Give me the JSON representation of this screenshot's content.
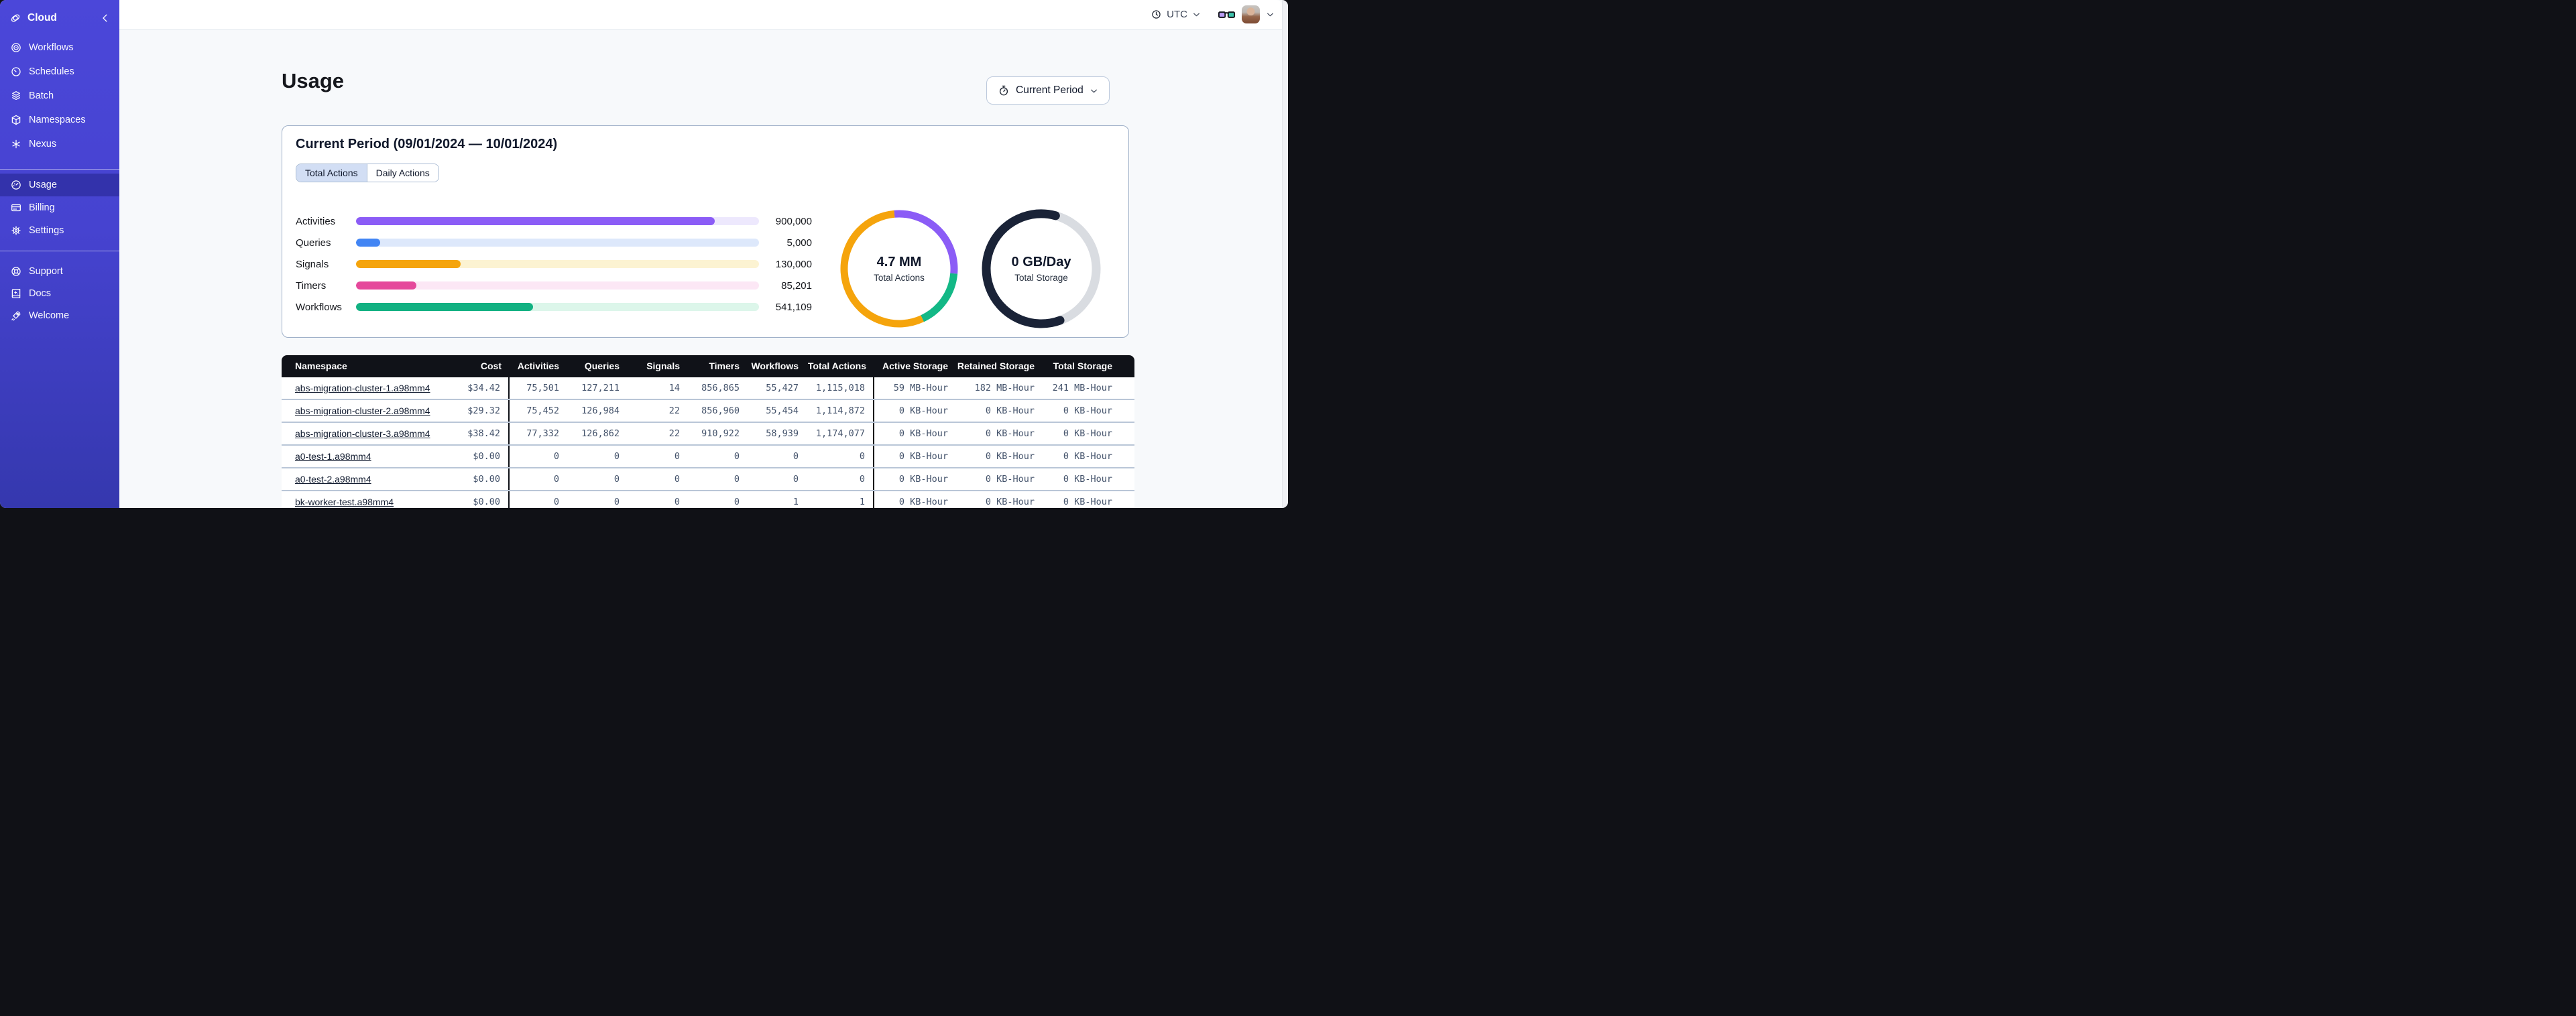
{
  "sidebar": {
    "brand": {
      "label": "Cloud"
    },
    "nav_primary": [
      {
        "label": "Workflows"
      },
      {
        "label": "Schedules"
      },
      {
        "label": "Batch"
      },
      {
        "label": "Namespaces"
      },
      {
        "label": "Nexus"
      }
    ],
    "nav_account": [
      {
        "label": "Usage",
        "active": true
      },
      {
        "label": "Billing",
        "active": false
      },
      {
        "label": "Settings",
        "active": false
      }
    ],
    "nav_footer": [
      {
        "label": "Support"
      },
      {
        "label": "Docs"
      },
      {
        "label": "Welcome"
      }
    ]
  },
  "header": {
    "timezone": "UTC"
  },
  "page": {
    "title": "Usage",
    "period_button_label": "Current Period"
  },
  "usage_card": {
    "title": "Current Period (09/01/2024 — 10/01/2024)",
    "tabs": [
      {
        "label": "Total Actions",
        "active": true
      },
      {
        "label": "Daily Actions",
        "active": false
      }
    ]
  },
  "chart_data": [
    {
      "type": "bar",
      "title": "Actions by type (current period)",
      "categories": [
        "Activities",
        "Queries",
        "Signals",
        "Timers",
        "Workflows"
      ],
      "values": [
        900000,
        5000,
        130000,
        85201,
        541109
      ],
      "value_labels": [
        "900,000",
        "5,000",
        "130,000",
        "85,201",
        "541,109"
      ],
      "fill_fractions": [
        0.89,
        0.06,
        0.26,
        0.15,
        0.44
      ],
      "bar_colors": [
        "#8B5CF6",
        "#4285F4",
        "#F5A40C",
        "#E5489B",
        "#12B182"
      ],
      "track_colors": [
        "#EDE8FD",
        "#DDE8FB",
        "#FCF3D2",
        "#FCE7F5",
        "#DCF6EA"
      ]
    },
    {
      "type": "donut",
      "center_value": "4.7 MM",
      "center_label": "Total Actions",
      "segments": [
        {
          "name": "activities",
          "color": "#8B5CF6",
          "start": 355,
          "sweep": 100
        },
        {
          "name": "workflows",
          "color": "#13B886",
          "start": 95,
          "sweep": 60
        },
        {
          "name": "other-actions",
          "color": "#F5A40C",
          "start": 155,
          "sweep": 200
        }
      ]
    },
    {
      "type": "donut",
      "center_value": "0 GB/Day",
      "center_label": "Total Storage",
      "segments": [
        {
          "name": "storage-free",
          "color": "#D9DCE1",
          "start": 15,
          "sweep": 145
        },
        {
          "name": "storage-used",
          "color": "#1A2337",
          "start": 160,
          "sweep": 215,
          "cap": "round"
        }
      ]
    }
  ],
  "table": {
    "columns": [
      "Namespace",
      "Cost",
      "Activities",
      "Queries",
      "Signals",
      "Timers",
      "Workflows",
      "Total Actions",
      "Active Storage",
      "Retained Storage",
      "Total Storage"
    ],
    "rows": [
      [
        "abs-migration-cluster-1.a98mm4",
        "$34.42",
        "75,501",
        "127,211",
        "14",
        "856,865",
        "55,427",
        "1,115,018",
        "59 MB-Hour",
        "182 MB-Hour",
        "241 MB-Hour"
      ],
      [
        "abs-migration-cluster-2.a98mm4",
        "$29.32",
        "75,452",
        "126,984",
        "22",
        "856,960",
        "55,454",
        "1,114,872",
        "0 KB-Hour",
        "0 KB-Hour",
        "0 KB-Hour"
      ],
      [
        "abs-migration-cluster-3.a98mm4",
        "$38.42",
        "77,332",
        "126,862",
        "22",
        "910,922",
        "58,939",
        "1,174,077",
        "0 KB-Hour",
        "0 KB-Hour",
        "0 KB-Hour"
      ],
      [
        "a0-test-1.a98mm4",
        "$0.00",
        "0",
        "0",
        "0",
        "0",
        "0",
        "0",
        "0 KB-Hour",
        "0 KB-Hour",
        "0 KB-Hour"
      ],
      [
        "a0-test-2.a98mm4",
        "$0.00",
        "0",
        "0",
        "0",
        "0",
        "0",
        "0",
        "0 KB-Hour",
        "0 KB-Hour",
        "0 KB-Hour"
      ],
      [
        "bk-worker-test.a98mm4",
        "$0.00",
        "0",
        "0",
        "0",
        "0",
        "1",
        "1",
        "0 KB-Hour",
        "0 KB-Hour",
        "0 KB-Hour"
      ]
    ]
  }
}
